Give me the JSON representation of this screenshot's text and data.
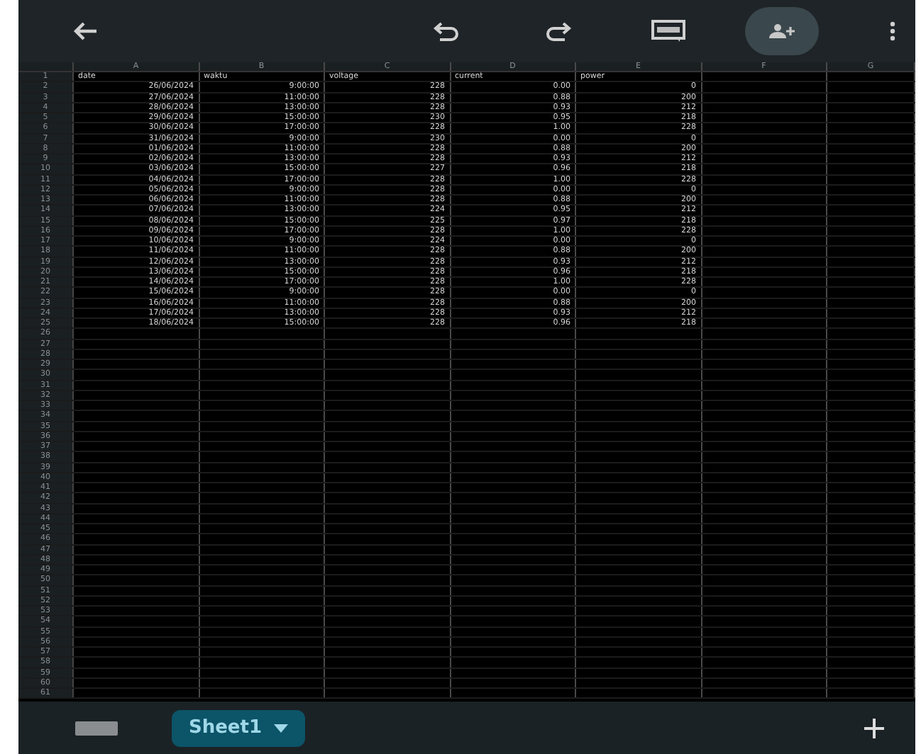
{
  "toolbar": {
    "share_button_active": true
  },
  "sheet": {
    "columns": [
      "A",
      "B",
      "C",
      "D",
      "E",
      "F",
      "G"
    ],
    "rows": [
      {
        "number": "1",
        "kind": "labels",
        "cells": [
          "date",
          "waktu",
          "voltage",
          "current",
          "power"
        ]
      },
      {
        "number": "2",
        "kind": "values",
        "cells": [
          "26/06/2024",
          "9:00:00",
          "228",
          "0.00",
          "0"
        ]
      },
      {
        "number": "3",
        "kind": "values",
        "cells": [
          "27/06/2024",
          "11:00:00",
          "228",
          "0.88",
          "200"
        ]
      },
      {
        "number": "4",
        "kind": "values",
        "cells": [
          "28/06/2024",
          "13:00:00",
          "228",
          "0.93",
          "212"
        ]
      },
      {
        "number": "5",
        "kind": "values",
        "cells": [
          "29/06/2024",
          "15:00:00",
          "230",
          "0.95",
          "218"
        ]
      },
      {
        "number": "6",
        "kind": "values",
        "cells": [
          "30/06/2024",
          "17:00:00",
          "228",
          "1.00",
          "228"
        ]
      },
      {
        "number": "7",
        "kind": "values",
        "cells": [
          "31/06/2024",
          "9:00:00",
          "230",
          "0.00",
          "0"
        ]
      },
      {
        "number": "8",
        "kind": "values",
        "cells": [
          "01/06/2024",
          "11:00:00",
          "228",
          "0.88",
          "200"
        ]
      },
      {
        "number": "9",
        "kind": "values",
        "cells": [
          "02/06/2024",
          "13:00:00",
          "228",
          "0.93",
          "212"
        ]
      },
      {
        "number": "10",
        "kind": "values",
        "cells": [
          "03/06/2024",
          "15:00:00",
          "227",
          "0.96",
          "218"
        ]
      },
      {
        "number": "11",
        "kind": "values",
        "cells": [
          "04/06/2024",
          "17:00:00",
          "228",
          "1.00",
          "228"
        ]
      },
      {
        "number": "12",
        "kind": "values",
        "cells": [
          "05/06/2024",
          "9:00:00",
          "228",
          "0.00",
          "0"
        ]
      },
      {
        "number": "13",
        "kind": "values",
        "cells": [
          "06/06/2024",
          "11:00:00",
          "228",
          "0.88",
          "200"
        ]
      },
      {
        "number": "14",
        "kind": "values",
        "cells": [
          "07/06/2024",
          "13:00:00",
          "224",
          "0.95",
          "212"
        ]
      },
      {
        "number": "15",
        "kind": "values",
        "cells": [
          "08/06/2024",
          "15:00:00",
          "225",
          "0.97",
          "218"
        ]
      },
      {
        "number": "16",
        "kind": "values",
        "cells": [
          "09/06/2024",
          "17:00:00",
          "228",
          "1.00",
          "228"
        ]
      },
      {
        "number": "17",
        "kind": "values",
        "cells": [
          "10/06/2024",
          "9:00:00",
          "224",
          "0.00",
          "0"
        ]
      },
      {
        "number": "18",
        "kind": "values",
        "cells": [
          "11/06/2024",
          "11:00:00",
          "228",
          "0.88",
          "200"
        ]
      },
      {
        "number": "19",
        "kind": "values",
        "cells": [
          "12/06/2024",
          "13:00:00",
          "228",
          "0.93",
          "212"
        ]
      },
      {
        "number": "20",
        "kind": "values",
        "cells": [
          "13/06/2024",
          "15:00:00",
          "228",
          "0.96",
          "218"
        ]
      },
      {
        "number": "21",
        "kind": "values",
        "cells": [
          "14/06/2024",
          "17:00:00",
          "228",
          "1.00",
          "228"
        ]
      },
      {
        "number": "22",
        "kind": "values",
        "cells": [
          "15/06/2024",
          "9:00:00",
          "228",
          "0.00",
          "0"
        ]
      },
      {
        "number": "23",
        "kind": "values",
        "cells": [
          "16/06/2024",
          "11:00:00",
          "228",
          "0.88",
          "200"
        ]
      },
      {
        "number": "24",
        "kind": "values",
        "cells": [
          "17/06/2024",
          "13:00:00",
          "228",
          "0.93",
          "212"
        ]
      },
      {
        "number": "25",
        "kind": "values",
        "cells": [
          "18/06/2024",
          "15:00:00",
          "228",
          "0.96",
          "218"
        ]
      },
      {
        "number": "26",
        "kind": "blank"
      },
      {
        "number": "27",
        "kind": "blank"
      },
      {
        "number": "28",
        "kind": "blank"
      },
      {
        "number": "29",
        "kind": "blank"
      },
      {
        "number": "30",
        "kind": "blank"
      },
      {
        "number": "31",
        "kind": "blank"
      },
      {
        "number": "32",
        "kind": "blank"
      },
      {
        "number": "33",
        "kind": "blank"
      },
      {
        "number": "34",
        "kind": "blank"
      },
      {
        "number": "35",
        "kind": "blank"
      },
      {
        "number": "36",
        "kind": "blank"
      },
      {
        "number": "37",
        "kind": "blank"
      },
      {
        "number": "38",
        "kind": "blank"
      },
      {
        "number": "39",
        "kind": "blank"
      },
      {
        "number": "40",
        "kind": "blank"
      },
      {
        "number": "41",
        "kind": "blank"
      },
      {
        "number": "42",
        "kind": "blank"
      },
      {
        "number": "43",
        "kind": "blank"
      },
      {
        "number": "44",
        "kind": "blank"
      },
      {
        "number": "45",
        "kind": "blank"
      },
      {
        "number": "46",
        "kind": "blank"
      },
      {
        "number": "47",
        "kind": "blank"
      },
      {
        "number": "48",
        "kind": "blank"
      },
      {
        "number": "49",
        "kind": "blank"
      },
      {
        "number": "50",
        "kind": "blank"
      },
      {
        "number": "51",
        "kind": "blank"
      },
      {
        "number": "52",
        "kind": "blank"
      },
      {
        "number": "53",
        "kind": "blank"
      },
      {
        "number": "54",
        "kind": "blank"
      },
      {
        "number": "55",
        "kind": "blank"
      },
      {
        "number": "56",
        "kind": "blank"
      },
      {
        "number": "57",
        "kind": "blank"
      },
      {
        "number": "58",
        "kind": "blank"
      },
      {
        "number": "59",
        "kind": "blank"
      },
      {
        "number": "60",
        "kind": "blank"
      },
      {
        "number": "61",
        "kind": "blank"
      }
    ]
  },
  "sheet_tabs": [
    {
      "label": "Sheet1",
      "selected": true
    }
  ]
}
